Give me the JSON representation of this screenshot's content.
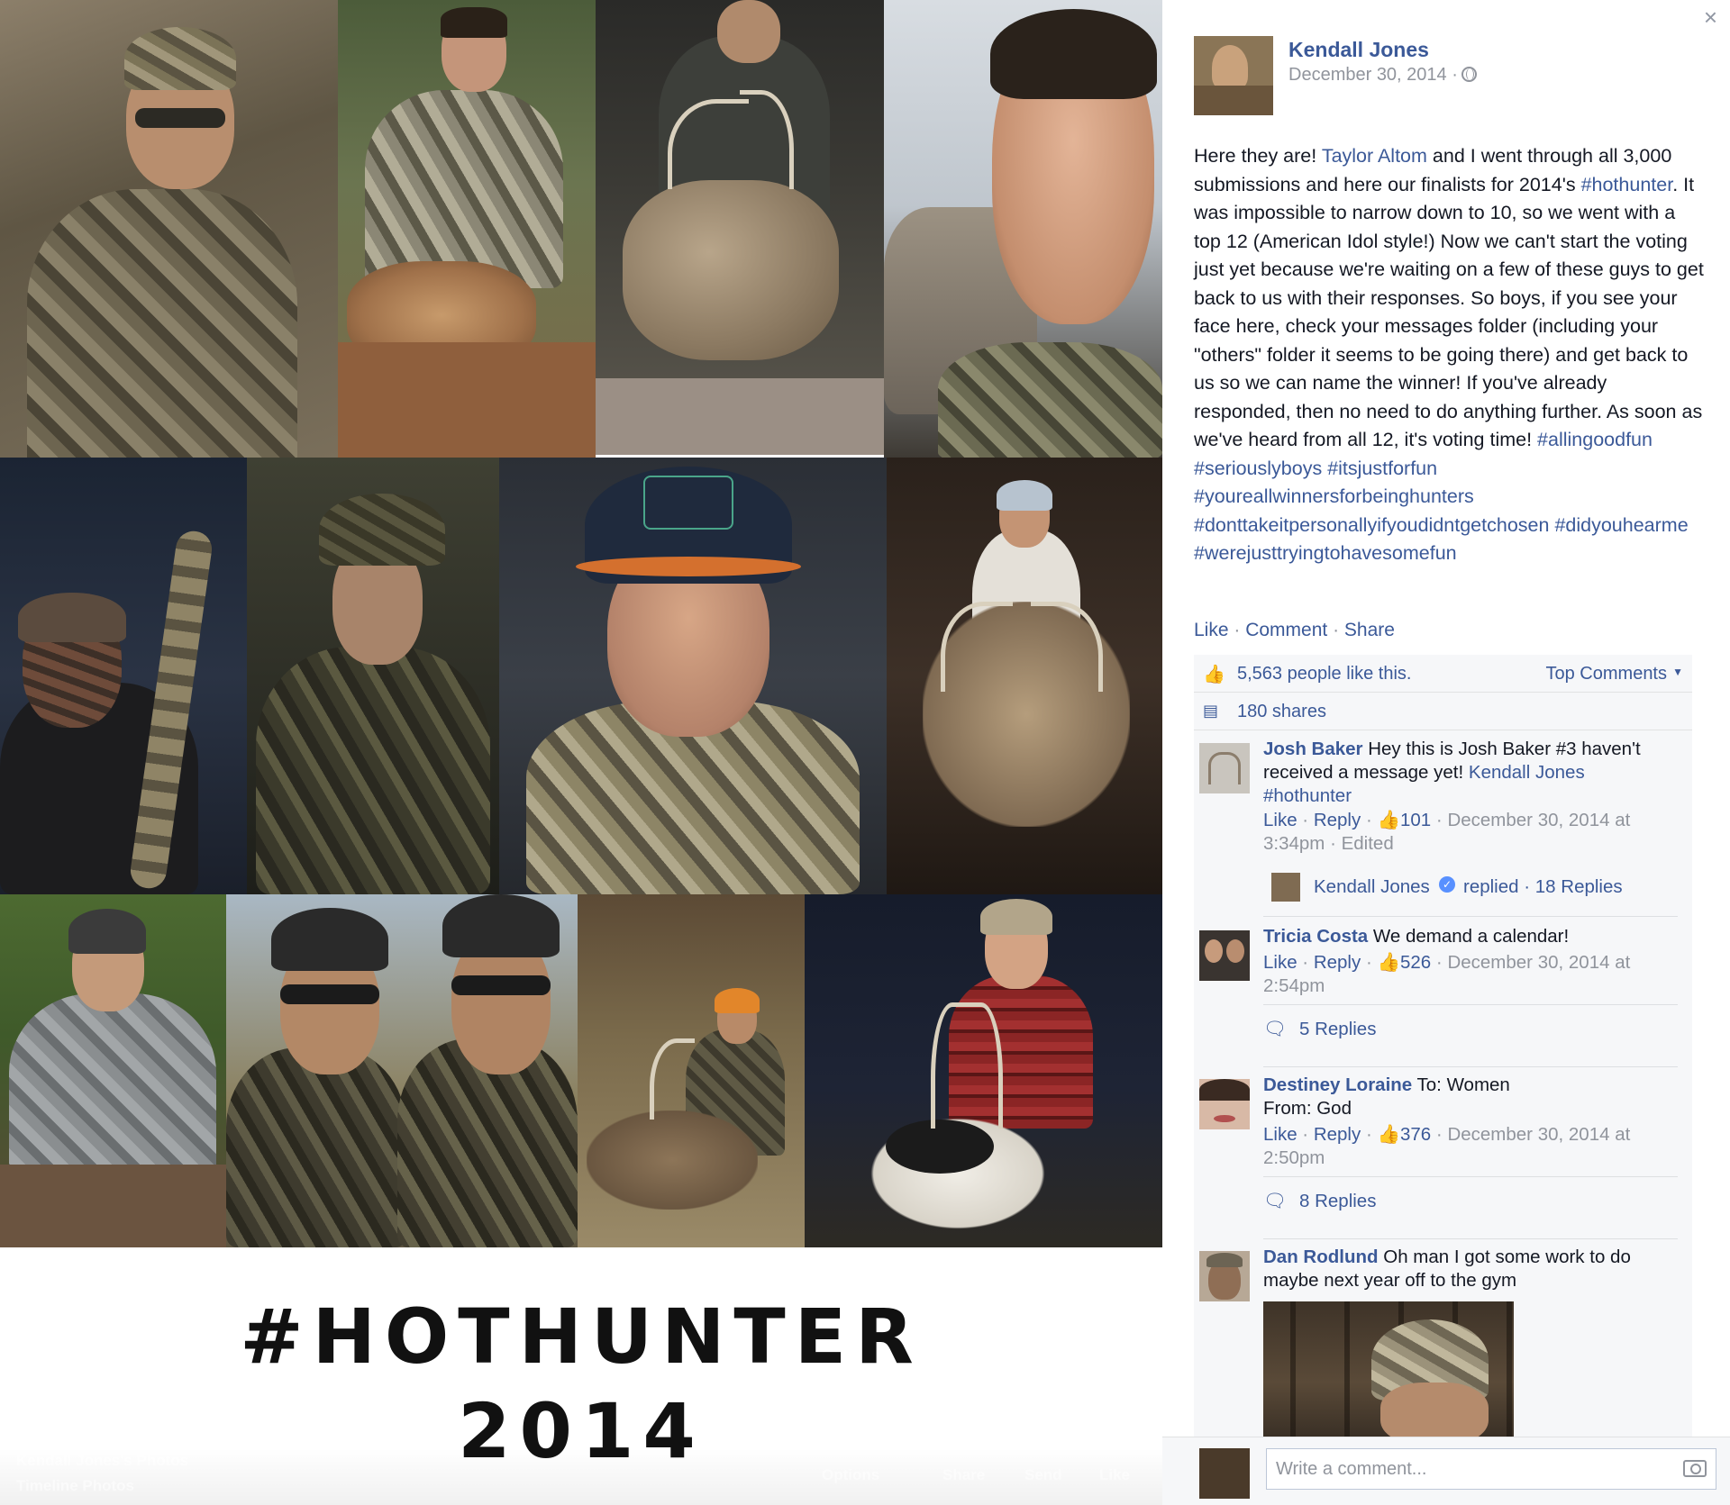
{
  "viewer": {
    "poster_title": "#HOTHUNTER",
    "poster_year": "2014",
    "album_name": "Kendall Jones's Photos",
    "album_sub": "Timeline Photos",
    "actions": [
      "Options",
      "Share",
      "Send",
      "Like"
    ]
  },
  "panel": {
    "close": "×",
    "author": "Kendall Jones",
    "date": "December 30, 2014 ·",
    "caption": [
      {
        "t": "Here they are! "
      },
      {
        "t": "Taylor Altom",
        "link": true
      },
      {
        "t": " and I went through all 3,000 submissions and here our finalists for 2014's "
      },
      {
        "t": "#hothunter",
        "link": true
      },
      {
        "t": ". It was impossible to narrow down to 10, so we went with a top 12 (American Idol style!) Now we can't start the voting just yet because we're waiting on a few of these guys to get back to us with their responses. So boys, if you see your face here, check your messages folder (including your \"others\" folder it seems to be going there) and get back to us so we can name the winner! If you've already responded, then no need to do anything further. As soon as we've heard from all 12, it's voting time! "
      },
      {
        "t": "#allingoodfun",
        "link": true
      },
      {
        "t": " "
      },
      {
        "t": "#seriouslyboys",
        "link": true
      },
      {
        "t": " "
      },
      {
        "t": "#itsjustforfun",
        "link": true
      },
      {
        "t": " "
      },
      {
        "t": "#youreallwinnersforbeinghunters",
        "link": true
      },
      {
        "t": " "
      },
      {
        "t": "#donttakeitpersonallyifyoudidntgetchosen",
        "link": true
      },
      {
        "t": " "
      },
      {
        "t": "#didyouhearme",
        "link": true
      },
      {
        "t": " "
      },
      {
        "t": "#werejusttryingtohavesomefun",
        "link": true
      }
    ],
    "actions": {
      "like": "Like",
      "comment": "Comment",
      "share": "Share"
    },
    "likes_text": "5,563 people like this.",
    "top_comments": "Top Comments",
    "shares_text": "180 shares",
    "comments": [
      {
        "author": "Josh Baker",
        "text": " Hey this is Josh Baker #3 haven't received a message yet! ",
        "mention": "Kendall Jones",
        "hashtag": "#hothunter",
        "like": "Like",
        "reply": "Reply",
        "likes": "101",
        "time": "December 30, 2014 at 3:34pm",
        "edited": "Edited",
        "reply_author": "Kendall Jones",
        "replied": "replied",
        "replies": "18 Replies"
      },
      {
        "author": "Tricia Costa",
        "text": " We demand a calendar!",
        "like": "Like",
        "reply": "Reply",
        "likes": "526",
        "time": "December 30, 2014 at 2:54pm",
        "replies": "5 Replies"
      },
      {
        "author": "Destiney Loraine",
        "text": " To: Women",
        "text2": "From: God",
        "like": "Like",
        "reply": "Reply",
        "likes": "376",
        "time": "December 30, 2014 at 2:50pm",
        "replies": "8 Replies"
      },
      {
        "author": "Dan Rodlund",
        "text": " Oh man I got some work to do maybe next year off to the gym"
      }
    ],
    "write_placeholder": "Write a comment..."
  },
  "colors": {
    "link": "#3b5998",
    "meta": "#90949c",
    "ufi_bg": "#f6f7f9"
  }
}
